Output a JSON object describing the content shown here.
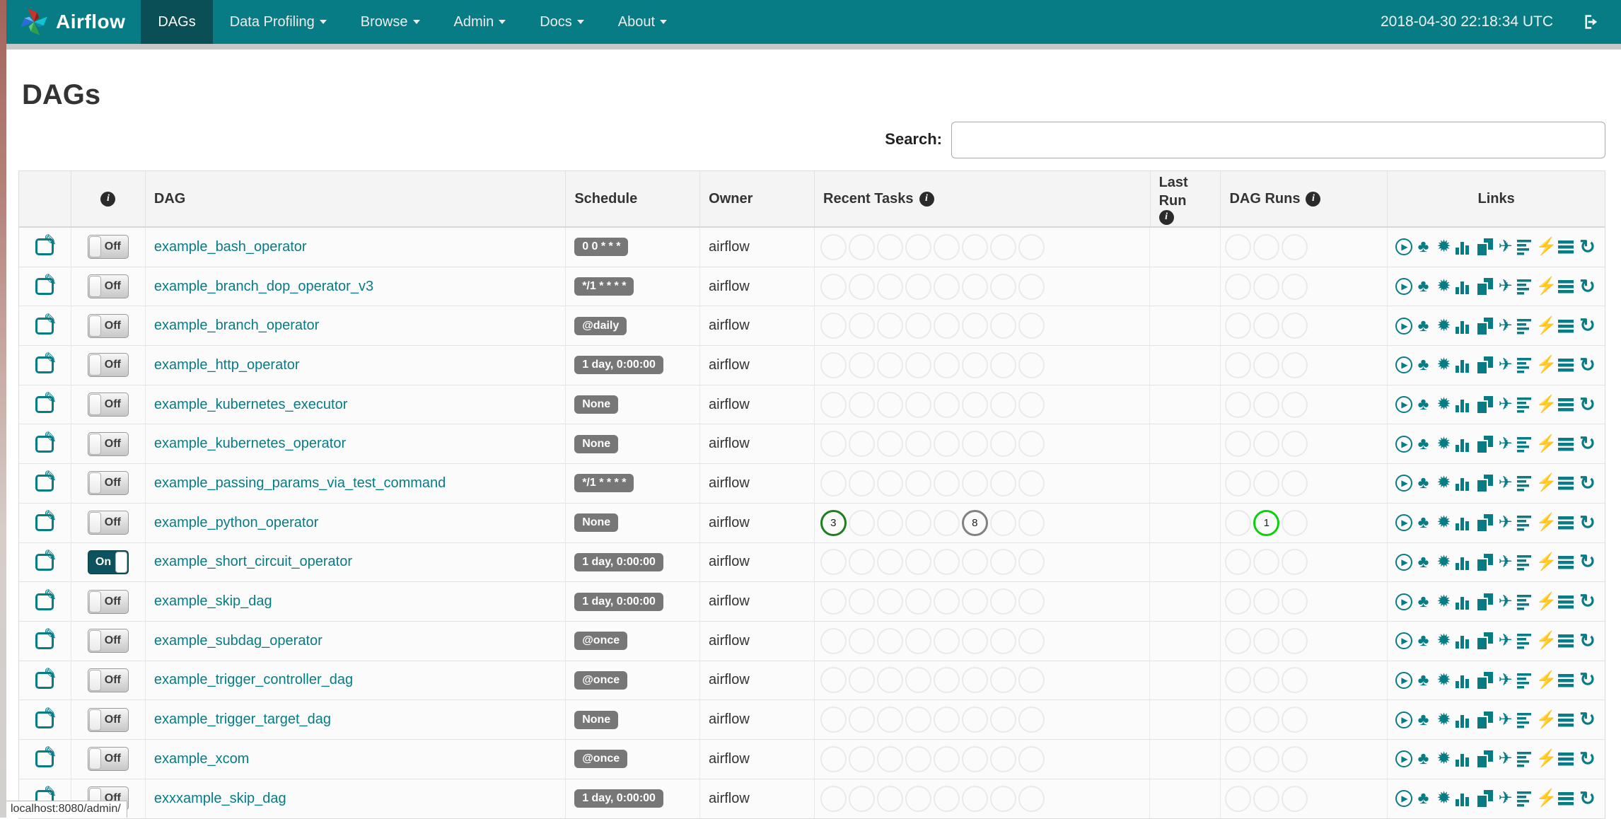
{
  "navbar": {
    "brand": "Airflow",
    "items": [
      {
        "label": "DAGs",
        "active": true,
        "caret": false
      },
      {
        "label": "Data Profiling",
        "active": false,
        "caret": true
      },
      {
        "label": "Browse",
        "active": false,
        "caret": true
      },
      {
        "label": "Admin",
        "active": false,
        "caret": true
      },
      {
        "label": "Docs",
        "active": false,
        "caret": true
      },
      {
        "label": "About",
        "active": false,
        "caret": true
      }
    ],
    "clock": "2018-04-30 22:18:34 UTC"
  },
  "page": {
    "title": "DAGs",
    "search_label": "Search:",
    "search_value": "",
    "status_text": "localhost:8080/admin/"
  },
  "colors": {
    "brand_teal": "#077c85",
    "active_nav": "#0a4f55",
    "badge_grey": "#777777",
    "task_success": "#1e7d1e",
    "task_queued": "#818181",
    "dagrun_running": "#0ad20a",
    "empty_circle_border": "#eaeaea"
  },
  "icons": {
    "info_glyph": "i"
  },
  "table": {
    "columns": {
      "dag": "DAG",
      "schedule": "Schedule",
      "owner": "Owner",
      "recent_tasks": "Recent Tasks",
      "last_run": "Last Run",
      "dag_runs": "DAG Runs",
      "links": "Links"
    },
    "recent_task_slots": 8,
    "dag_run_slots": 3,
    "link_icons": [
      {
        "name": "trigger-dag-icon",
        "kind": "circled",
        "glyph": "▶"
      },
      {
        "name": "tree-view-icon",
        "kind": "glyph",
        "glyph": "♣"
      },
      {
        "name": "graph-view-icon",
        "kind": "glyph",
        "glyph": "✹"
      },
      {
        "name": "task-duration-icon",
        "kind": "bars",
        "glyph": ""
      },
      {
        "name": "task-tries-icon",
        "kind": "pages",
        "glyph": ""
      },
      {
        "name": "landing-times-icon",
        "kind": "glyph",
        "glyph": "✈"
      },
      {
        "name": "gantt-view-icon",
        "kind": "lines-left",
        "glyph": ""
      },
      {
        "name": "code-view-icon",
        "kind": "glyph",
        "glyph": "⚡"
      },
      {
        "name": "logs-icon",
        "kind": "lines",
        "glyph": ""
      },
      {
        "name": "refresh-icon",
        "kind": "refresh",
        "glyph": "↻"
      }
    ],
    "rows": [
      {
        "name": "example_bash_operator",
        "toggle": "Off",
        "schedule": "0 0 * * *",
        "owner": "airflow",
        "recent_tasks": [],
        "dag_runs": []
      },
      {
        "name": "example_branch_dop_operator_v3",
        "toggle": "Off",
        "schedule": "*/1 * * * *",
        "owner": "airflow",
        "recent_tasks": [],
        "dag_runs": []
      },
      {
        "name": "example_branch_operator",
        "toggle": "Off",
        "schedule": "@daily",
        "owner": "airflow",
        "recent_tasks": [],
        "dag_runs": []
      },
      {
        "name": "example_http_operator",
        "toggle": "Off",
        "schedule": "1 day, 0:00:00",
        "owner": "airflow",
        "recent_tasks": [],
        "dag_runs": []
      },
      {
        "name": "example_kubernetes_executor",
        "toggle": "Off",
        "schedule": "None",
        "owner": "airflow",
        "recent_tasks": [],
        "dag_runs": []
      },
      {
        "name": "example_kubernetes_operator",
        "toggle": "Off",
        "schedule": "None",
        "owner": "airflow",
        "recent_tasks": [],
        "dag_runs": []
      },
      {
        "name": "example_passing_params_via_test_command",
        "toggle": "Off",
        "schedule": "*/1 * * * *",
        "owner": "airflow",
        "recent_tasks": [],
        "dag_runs": []
      },
      {
        "name": "example_python_operator",
        "toggle": "Off",
        "schedule": "None",
        "owner": "airflow",
        "recent_tasks": [
          {
            "slot": 0,
            "count": "3",
            "state": "success",
            "color": "#1e7d1e"
          },
          {
            "slot": 5,
            "count": "8",
            "state": "queued",
            "color": "#818181"
          }
        ],
        "dag_runs": [
          {
            "slot": 1,
            "count": "1",
            "state": "running",
            "color": "#0ad20a"
          }
        ]
      },
      {
        "name": "example_short_circuit_operator",
        "toggle": "On",
        "schedule": "1 day, 0:00:00",
        "owner": "airflow",
        "recent_tasks": [],
        "dag_runs": []
      },
      {
        "name": "example_skip_dag",
        "toggle": "Off",
        "schedule": "1 day, 0:00:00",
        "owner": "airflow",
        "recent_tasks": [],
        "dag_runs": []
      },
      {
        "name": "example_subdag_operator",
        "toggle": "Off",
        "schedule": "@once",
        "owner": "airflow",
        "recent_tasks": [],
        "dag_runs": []
      },
      {
        "name": "example_trigger_controller_dag",
        "toggle": "Off",
        "schedule": "@once",
        "owner": "airflow",
        "recent_tasks": [],
        "dag_runs": []
      },
      {
        "name": "example_trigger_target_dag",
        "toggle": "Off",
        "schedule": "None",
        "owner": "airflow",
        "recent_tasks": [],
        "dag_runs": []
      },
      {
        "name": "example_xcom",
        "toggle": "Off",
        "schedule": "@once",
        "owner": "airflow",
        "recent_tasks": [],
        "dag_runs": []
      },
      {
        "name": "exxxample_skip_dag",
        "toggle": "Off",
        "schedule": "1 day, 0:00:00",
        "owner": "airflow",
        "recent_tasks": [],
        "dag_runs": []
      }
    ]
  }
}
